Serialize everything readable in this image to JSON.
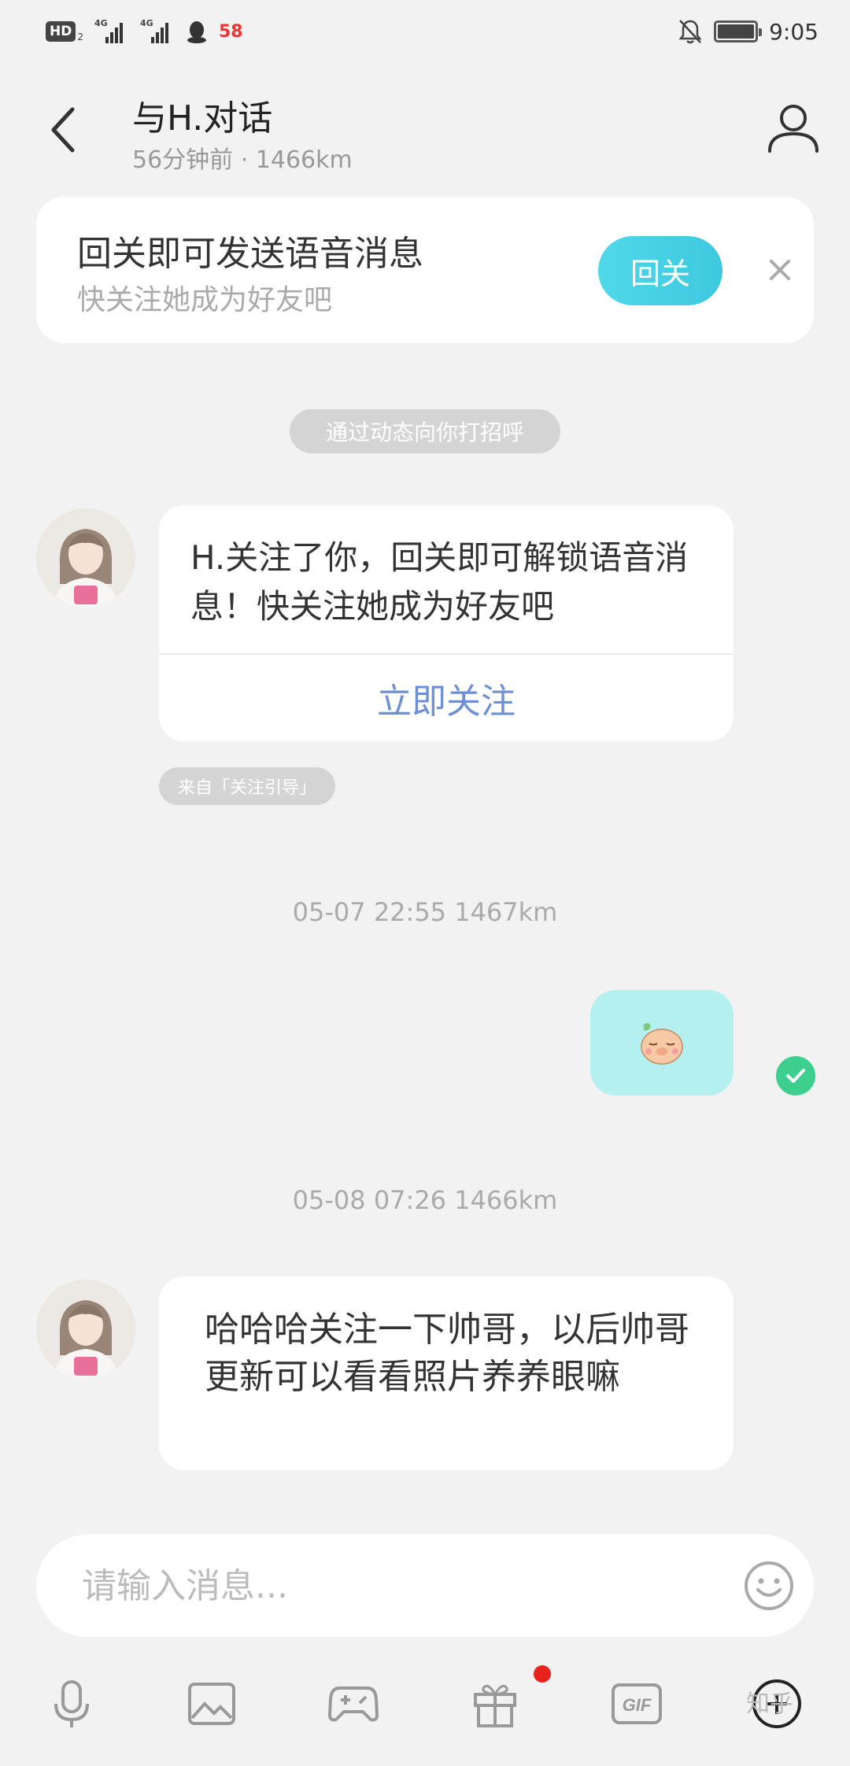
{
  "status_bar": {
    "hd_label": "HD",
    "hd_sub": "2",
    "signal_1_label": "4G",
    "signal_2_label": "4G",
    "app_badge": "58",
    "time": "9:05",
    "icons": [
      "hd-icon",
      "signal-icon",
      "signal-icon",
      "qq-icon",
      "58-app-icon",
      "mute-bell-icon",
      "battery-icon"
    ]
  },
  "header": {
    "title": "与H.对话",
    "subtitle": "56分钟前 · 1466km",
    "back_icon": "chevron-left-icon",
    "profile_icon": "user-icon"
  },
  "follow_banner": {
    "title": "回关即可发送语音消息",
    "subtitle": "快关注她成为好友吧",
    "button_label": "回关",
    "close_icon": "close-icon",
    "accent": "#45d0e6"
  },
  "chat": {
    "system_notice": "通过动态向你打招呼",
    "follow_card": {
      "text": "H.关注了你，回关即可解锁语音消息！快关注她成为好友吧",
      "action_label": "立即关注",
      "source_label": "来自「关注引导」"
    },
    "timestamp_1": "05-07 22:55   1467km",
    "sent_sticker": "sleepy-pig-sticker",
    "sent_status": "check-icon",
    "timestamp_2": "05-08 07:26   1466km",
    "received_text": "哈哈哈关注一下帅哥，以后帅哥更新可以看看照片养养眼嘛"
  },
  "input": {
    "placeholder": "请输入消息...",
    "emoji_icon": "smile-icon"
  },
  "toolbar": {
    "items": [
      "microphone-icon",
      "image-icon",
      "game-icon",
      "gift-icon",
      "gif-icon",
      "plus-circle-icon"
    ],
    "gif_label": "GIF",
    "watermark": "知乎"
  },
  "colors": {
    "sent_bubble": "#b4f0ef",
    "link": "#6c8fd6",
    "status_ok": "#3ccf8e",
    "notification_dot": "#e8221c"
  }
}
